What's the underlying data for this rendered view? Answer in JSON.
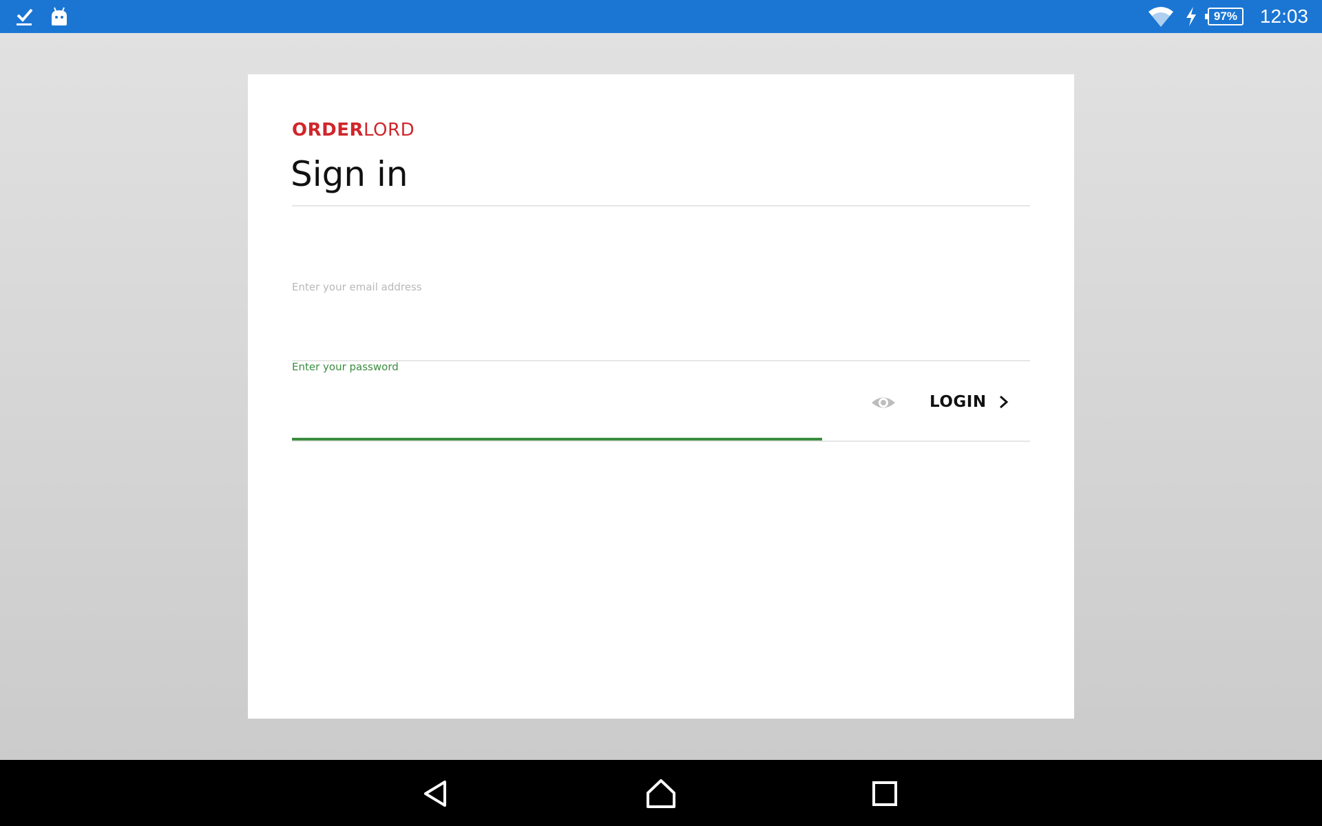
{
  "status_bar": {
    "left_icons": [
      "checkmark-download-icon",
      "android-robot-icon"
    ],
    "right_icons": [
      "wifi-icon",
      "charging-bolt-icon",
      "battery-icon"
    ],
    "battery_percent": "97%",
    "time": "12:03"
  },
  "card": {
    "logo": {
      "bold": "ORDER",
      "light": "LORD"
    },
    "title": "Sign in",
    "email_field": {
      "placeholder": "Enter your email address",
      "value": ""
    },
    "password_field": {
      "label": "Enter your password",
      "value": ""
    },
    "show_password_icon": "eye-icon",
    "login_button": {
      "label": "LOGIN",
      "icon": "chevron-right-icon"
    }
  },
  "nav_bar": {
    "buttons": [
      "back-icon",
      "home-icon",
      "recents-icon"
    ]
  },
  "colors": {
    "status_bar": "#1b76d3",
    "brand_red": "#d0262b",
    "active_green": "#3a8c3e",
    "placeholder_grey": "#b8b8b8",
    "nav_bar": "#000000"
  }
}
